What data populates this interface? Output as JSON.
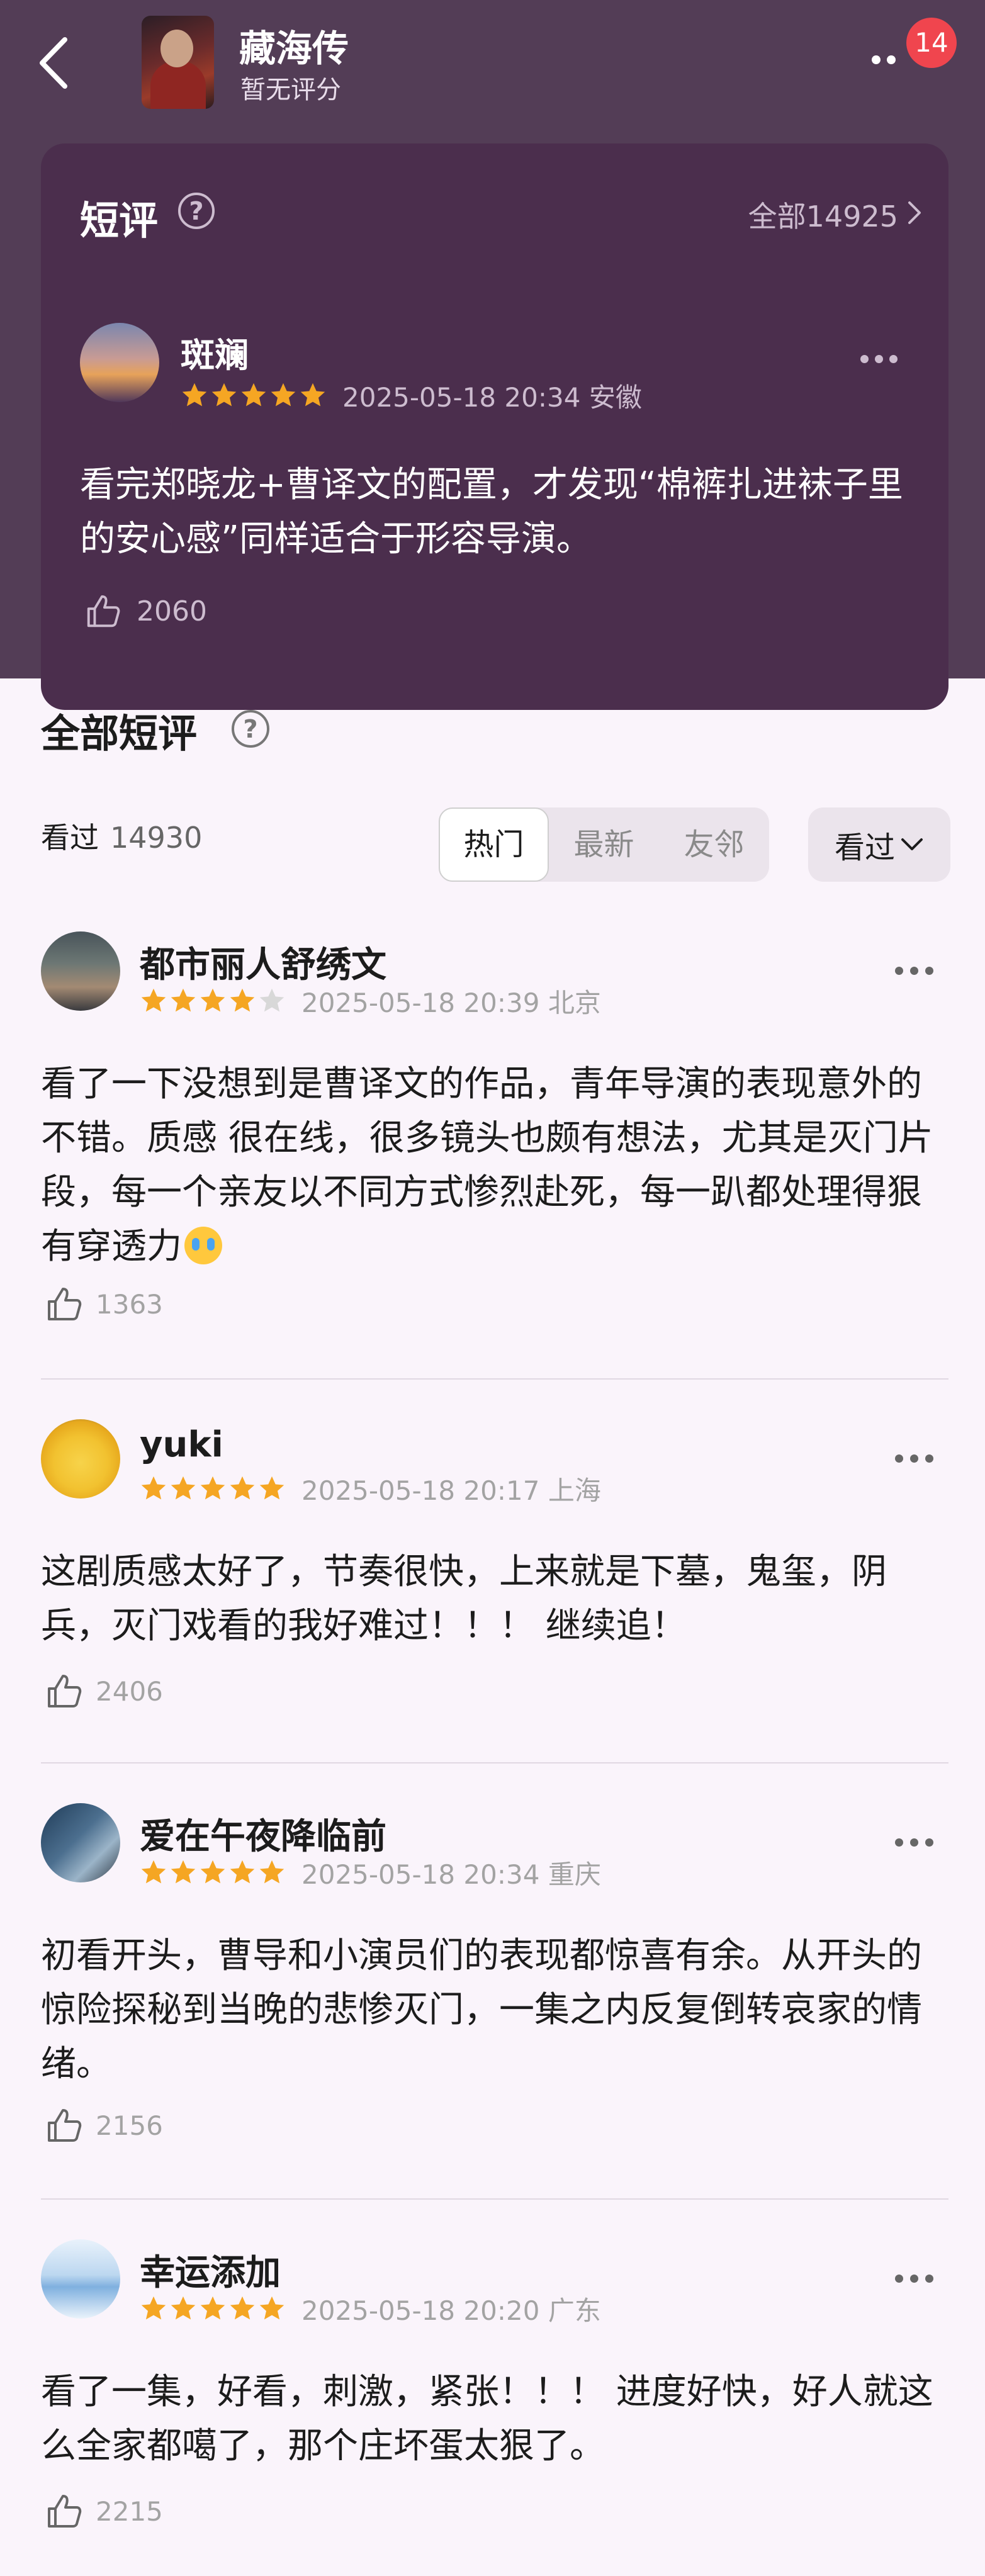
{
  "header": {
    "title": "藏海传",
    "rating_text": "暂无评分",
    "badge_count": "14"
  },
  "featured": {
    "title": "短评",
    "help_symbol": "?",
    "all_link": "全部14925",
    "review": {
      "name": "斑斓",
      "stars": 5,
      "date_location": "2025-05-18 20:34 安徽",
      "text": "看完郑晓龙+曹译文的配置，才发现“棉裤扎进袜子里的安心感”同样适合于形容导演。",
      "likes": "2060"
    }
  },
  "section": {
    "title": "全部短评",
    "help_symbol": "?",
    "count_label": "看过",
    "count_value": "14930",
    "tabs": [
      "热门",
      "最新",
      "友邻"
    ],
    "filter_label": "看过"
  },
  "reviews": [
    {
      "name": "都市丽人舒绣文",
      "stars": 4,
      "date_location": "2025-05-18 20:39 北京",
      "text": "看了一下没想到是曹译文的作品，青年导演的表现意外的不错。质感 很在线，很多镜头也颇有想法，尤其是灭门片段，每一个亲友以不同方式惨烈赴死，每一趴都处理得狠有穿透力",
      "likes": "1363"
    },
    {
      "name": "yuki",
      "stars": 5,
      "date_location": "2025-05-18 20:17 上海",
      "text": "这剧质感太好了，节奏很快，上来就是下墓，鬼玺，阴兵，灭门戏看的我好难过！！！ 继续追！",
      "likes": "2406"
    },
    {
      "name": "爱在午夜降临前",
      "stars": 5,
      "date_location": "2025-05-18 20:34 重庆",
      "text": "初看开头，曹导和小演员们的表现都惊喜有余。从开头的惊险探秘到当晚的悲惨灭门，一集之内反复倒转哀家的情绪。",
      "likes": "2156"
    },
    {
      "name": "幸运添加",
      "stars": 5,
      "date_location": "2025-05-18 20:20 广东",
      "text": "看了一集，好看，刺激，紧张！！！ 进度好快，好人就这么全家都噶了，那个庄坏蛋太狠了。",
      "likes": "2215"
    }
  ]
}
